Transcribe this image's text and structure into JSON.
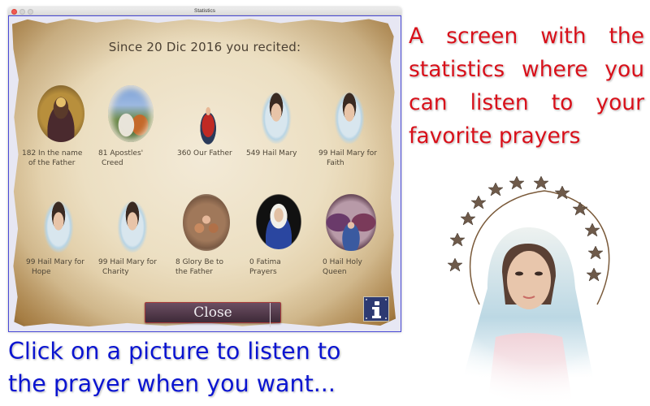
{
  "window": {
    "title": "Statistics",
    "controls": [
      "close",
      "minimize",
      "maximize"
    ]
  },
  "heading": "Since 20 Dic 2016 you recited:",
  "prayers": [
    {
      "count": 182,
      "label_line1": "182 In the name",
      "label_line2": "of the Father",
      "icon": "jesus-mosaic-picture"
    },
    {
      "count": 81,
      "label_line1": "81 Apostles'",
      "label_line2": "Creed",
      "icon": "baptism-picture"
    },
    {
      "count": 360,
      "label_line1": "360 Our Father",
      "label_line2": "",
      "icon": "jesus-praying-picture"
    },
    {
      "count": 549,
      "label_line1": "549 Hail Mary",
      "label_line2": "",
      "icon": "madonna-picture"
    },
    {
      "count": 99,
      "label_line1": "99 Hail Mary for",
      "label_line2": "Faith",
      "icon": "madonna-picture"
    },
    {
      "count": 99,
      "label_line1": "99 Hail Mary for",
      "label_line2": "Hope",
      "icon": "madonna-picture"
    },
    {
      "count": 99,
      "label_line1": "99 Hail Mary for",
      "label_line2": "Charity",
      "icon": "madonna-picture"
    },
    {
      "count": 8,
      "label_line1": "8 Glory Be to",
      "label_line2": "the Father",
      "icon": "holy-family-picture"
    },
    {
      "count": 0,
      "label_line1": "0 Fatima",
      "label_line2": "Prayers",
      "icon": "fatima-madonna-picture"
    },
    {
      "count": 0,
      "label_line1": "0 Hail Holy",
      "label_line2": "Queen",
      "icon": "coronation-picture"
    }
  ],
  "buttons": {
    "close_label": "Close",
    "info_label": "i"
  },
  "promo": {
    "right_text": "A screen with the statistics where you can listen to your favorite prayers",
    "bottom_line1": "Click on a picture to listen to",
    "bottom_line2": "the prayer when you want...",
    "right_color": "#d8101a",
    "bottom_color": "#0a14d0"
  }
}
